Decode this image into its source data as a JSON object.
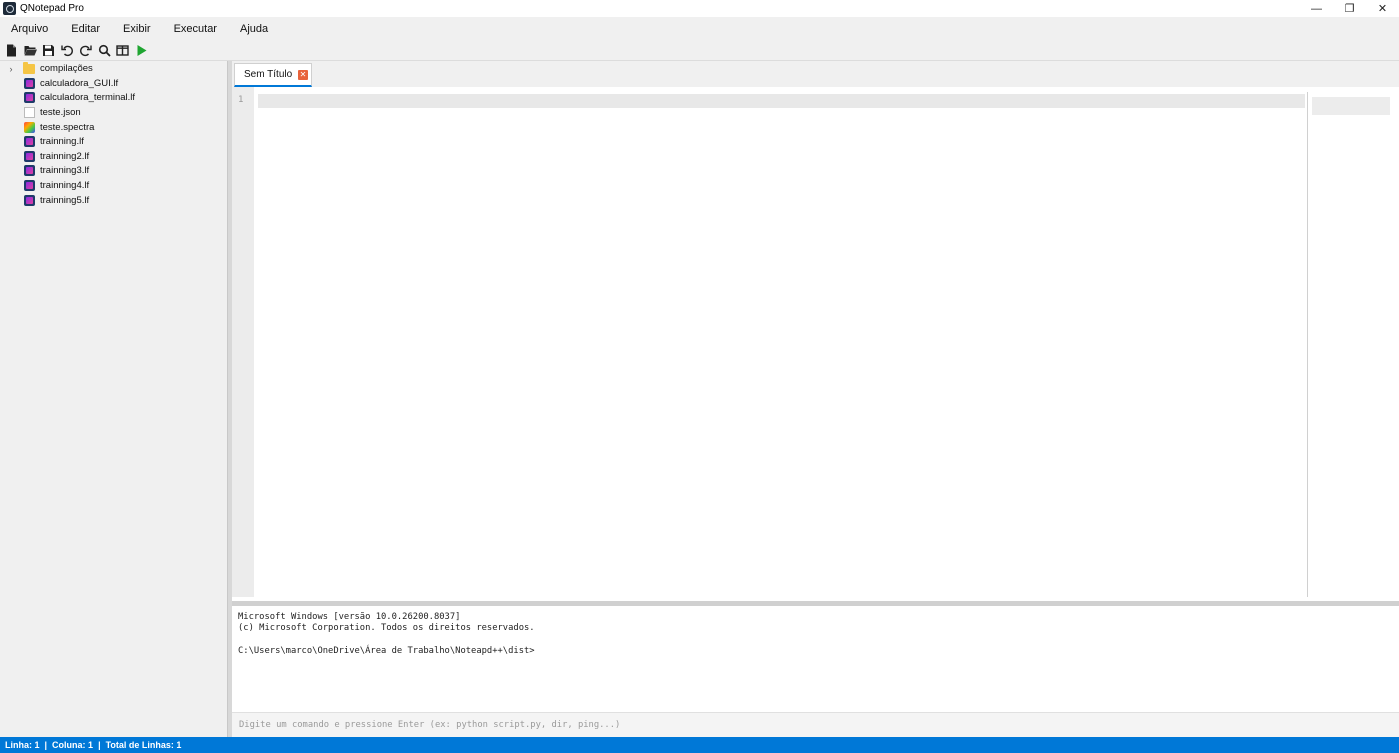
{
  "window": {
    "title": "QNotepad Pro",
    "controls": {
      "minimize": "—",
      "restore": "❐",
      "close": "✕"
    }
  },
  "menu": [
    "Arquivo",
    "Editar",
    "Exibir",
    "Executar",
    "Ajuda"
  ],
  "toolbar": {
    "icons": [
      "new-file-icon",
      "open-folder-icon",
      "save-icon",
      "undo-icon",
      "redo-icon",
      "search-icon",
      "split-view-icon",
      "run-icon"
    ]
  },
  "file_tree": {
    "folder": {
      "name": "compilações",
      "arrow": "›"
    },
    "files": [
      {
        "name": "calculadora_GUI.lf",
        "type": "lf"
      },
      {
        "name": "calculadora_terminal.lf",
        "type": "lf"
      },
      {
        "name": "teste.json",
        "type": "json"
      },
      {
        "name": "teste.spectra",
        "type": "spectra"
      },
      {
        "name": "trainning.lf",
        "type": "lf"
      },
      {
        "name": "trainning2.lf",
        "type": "lf"
      },
      {
        "name": "trainning3.lf",
        "type": "lf"
      },
      {
        "name": "trainning4.lf",
        "type": "lf"
      },
      {
        "name": "trainning5.lf",
        "type": "lf"
      }
    ]
  },
  "tabs": [
    {
      "label": "Sem Título",
      "close": "✕"
    }
  ],
  "editor": {
    "line_number": "1"
  },
  "terminal": {
    "lines": [
      "Microsoft Windows [versão 10.0.26200.8037]",
      "(c) Microsoft Corporation. Todos os direitos reservados.",
      "",
      "C:\\Users\\marco\\OneDrive\\Área de Trabalho\\Noteapd++\\dist>"
    ],
    "input_placeholder": "Digite um comando e pressione Enter (ex: python script.py, dir, ping...)"
  },
  "status": {
    "line": "Linha: 1",
    "column": "Coluna: 1",
    "total": "Total de Linhas: 1",
    "separator": "|"
  },
  "colors": {
    "accent": "#0078d7",
    "tab_close": "#e8633b",
    "run": "#1fa531"
  }
}
